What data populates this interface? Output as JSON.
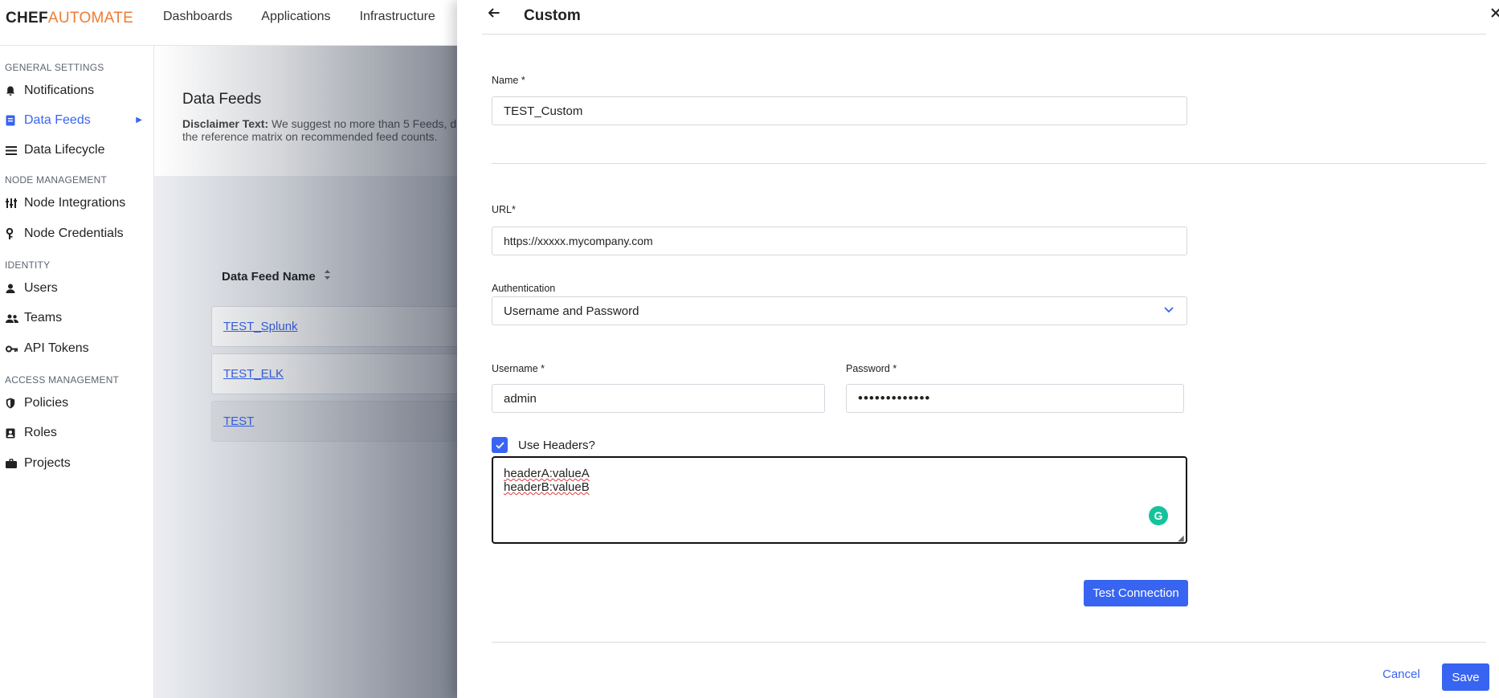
{
  "brand": {
    "chef": "CHEF",
    "automate": "AUTOMATE"
  },
  "topnav": [
    "Dashboards",
    "Applications",
    "Infrastructure"
  ],
  "sidebar": {
    "sections": {
      "general": "GENERAL SETTINGS",
      "node": "NODE MANAGEMENT",
      "identity": "IDENTITY",
      "access": "ACCESS MANAGEMENT"
    },
    "items": {
      "notifications": "Notifications",
      "data_feeds": "Data Feeds",
      "data_lifecycle": "Data Lifecycle",
      "node_integrations": "Node Integrations",
      "node_credentials": "Node Credentials",
      "users": "Users",
      "teams": "Teams",
      "api_tokens": "API Tokens",
      "policies": "Policies",
      "roles": "Roles",
      "projects": "Projects"
    }
  },
  "main": {
    "title": "Data Feeds",
    "disclaimer_label": "Disclaimer Text:",
    "disclaimer_text": " We suggest no more than 5 Feeds, d",
    "disclaimer_text_2": "the reference matrix on recommended feed counts.",
    "column_header": "Data Feed Name",
    "feeds": [
      "TEST_Splunk",
      "TEST_ELK",
      "TEST"
    ]
  },
  "drawer": {
    "title": "Custom",
    "name_label": "Name *",
    "name_value": "TEST_Custom",
    "url_label": "URL*",
    "url_value": "https://xxxxx.mycompany.com",
    "auth_label": "Authentication",
    "auth_value": "Username and Password",
    "username_label": "Username *",
    "username_value": "admin",
    "password_label": "Password *",
    "password_value": "•••••••••••••",
    "use_headers_label": "Use Headers?",
    "headers_line1": "headerA:valueA",
    "headers_line2": "headerB:valueB",
    "test_connection": "Test Connection",
    "cancel": "Cancel",
    "save": "Save"
  },
  "colors": {
    "accent": "#3864f2",
    "brand_orange": "#f07a32",
    "grammarly": "#15c39a"
  }
}
